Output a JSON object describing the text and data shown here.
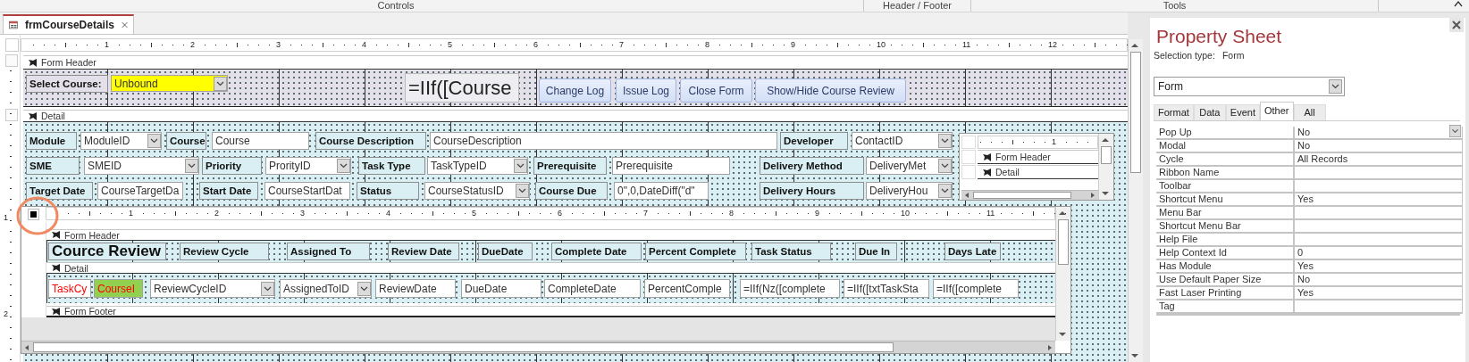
{
  "ribbon": {
    "groups": [
      "Controls",
      "Header / Footer",
      "Tools"
    ]
  },
  "document_tab": {
    "label": "frmCourseDetails",
    "selected": true
  },
  "design": {
    "ruler_numbers": [
      "1",
      "2",
      "3",
      "4",
      "5",
      "6",
      "7",
      "8",
      "9",
      "10",
      "11",
      "12"
    ],
    "vertical_ruler_numbers": [
      "1",
      "2"
    ],
    "form_header": {
      "title": "Form Header",
      "controls": [
        {
          "kind": "label",
          "text": "Select Course:"
        },
        {
          "kind": "combo",
          "text": "Unbound",
          "color": "#ffff00"
        },
        {
          "kind": "large-textbox",
          "text": "=IIf([Course"
        },
        {
          "kind": "button",
          "text": "Change Log"
        },
        {
          "kind": "button",
          "text": "Issue Log"
        },
        {
          "kind": "button",
          "text": "Close Form"
        },
        {
          "kind": "button",
          "text": "Show/Hide Course Review"
        }
      ]
    },
    "detail": {
      "title": "Detail",
      "controls": [
        {
          "kind": "label",
          "text": "Module"
        },
        {
          "kind": "combo",
          "text": "ModuleID"
        },
        {
          "kind": "label",
          "text": "Course"
        },
        {
          "kind": "textbox",
          "text": "Course"
        },
        {
          "kind": "label",
          "text": "Course Description"
        },
        {
          "kind": "textbox",
          "text": "CourseDescription"
        },
        {
          "kind": "label",
          "text": "Developer"
        },
        {
          "kind": "combo",
          "text": "ContactID"
        },
        {
          "kind": "label",
          "text": "SME"
        },
        {
          "kind": "combo",
          "text": "SMEID"
        },
        {
          "kind": "label",
          "text": "Priority"
        },
        {
          "kind": "combo",
          "text": "ProrityID"
        },
        {
          "kind": "label",
          "text": "Task Type"
        },
        {
          "kind": "combo",
          "text": "TaskTypeID"
        },
        {
          "kind": "label",
          "text": "Prerequisite"
        },
        {
          "kind": "textbox",
          "text": "Prerequisite"
        },
        {
          "kind": "label",
          "text": "Delivery Method"
        },
        {
          "kind": "combo",
          "text": "DeliveryMet"
        },
        {
          "kind": "label",
          "text": "Target Date"
        },
        {
          "kind": "textbox",
          "text": "CourseTargetDa"
        },
        {
          "kind": "label",
          "text": "Start Date"
        },
        {
          "kind": "textbox",
          "text": "CourseStartDat"
        },
        {
          "kind": "label",
          "text": "Status"
        },
        {
          "kind": "combo",
          "text": "CourseStatusID"
        },
        {
          "kind": "label",
          "text": "Course Due"
        },
        {
          "kind": "textbox",
          "text": "0\",0,DateDiff(\"d\""
        },
        {
          "kind": "label",
          "text": "Delivery Hours"
        },
        {
          "kind": "combo",
          "text": "DeliveryHou"
        }
      ],
      "mini_subform": {
        "ruler_numbers": [
          "1"
        ],
        "sections": [
          {
            "title": "Form Header"
          },
          {
            "title": "Detail"
          }
        ]
      },
      "subform": {
        "ruler_numbers": [
          "1",
          "2",
          "3",
          "4",
          "5",
          "6",
          "7",
          "8",
          "9",
          "10",
          "11"
        ],
        "header": {
          "title": "Form Header",
          "controls": [
            {
              "kind": "title-label",
              "text": "Cource Review"
            },
            {
              "kind": "label",
              "text": "Review Cycle"
            },
            {
              "kind": "label",
              "text": "Assigned To"
            },
            {
              "kind": "label",
              "text": "Review Date"
            },
            {
              "kind": "label",
              "text": "DueDate"
            },
            {
              "kind": "label",
              "text": "Complete Date"
            },
            {
              "kind": "label",
              "text": "Percent Complete"
            },
            {
              "kind": "label",
              "text": "Task Status"
            },
            {
              "kind": "label",
              "text": "Due In"
            },
            {
              "kind": "label",
              "text": "Days Late"
            }
          ]
        },
        "detail": {
          "title": "Detail",
          "controls": [
            {
              "kind": "textbox",
              "text": "TaskCy",
              "emphasis": true
            },
            {
              "kind": "textbox",
              "text": "CourseI",
              "emphasis": true,
              "color": "#92d050"
            },
            {
              "kind": "combo",
              "text": "ReviewCycleID"
            },
            {
              "kind": "combo",
              "text": "AssignedToID"
            },
            {
              "kind": "textbox",
              "text": "ReviewDate"
            },
            {
              "kind": "textbox",
              "text": "DueDate"
            },
            {
              "kind": "textbox",
              "text": "CompleteDate"
            },
            {
              "kind": "textbox",
              "text": "PercentComple"
            },
            {
              "kind": "textbox",
              "text": "=IIf(Nz([complete"
            },
            {
              "kind": "textbox",
              "text": "=IIf([txtTaskSta"
            },
            {
              "kind": "textbox",
              "text": "=IIf([complete"
            }
          ]
        },
        "footer": {
          "title": "Form Footer"
        }
      }
    }
  },
  "annotations": [
    {
      "kind": "circle"
    }
  ],
  "property_sheet": {
    "title": "Property Sheet",
    "selection_label": "Selection type:",
    "selection_value": "Form",
    "object": "Form",
    "tabs": [
      {
        "label": "Format",
        "selected": false
      },
      {
        "label": "Data",
        "selected": false
      },
      {
        "label": "Event",
        "selected": false
      },
      {
        "label": "Other",
        "selected": true
      },
      {
        "label": "All",
        "selected": false
      }
    ],
    "properties": [
      {
        "name": "Pop Up",
        "value": "No",
        "kind": "dropdown"
      },
      {
        "name": "Modal",
        "value": "No",
        "kind": "text"
      },
      {
        "name": "Cycle",
        "value": "All Records",
        "kind": "text"
      },
      {
        "name": "Ribbon Name",
        "kind": "text"
      },
      {
        "name": "Toolbar",
        "kind": "text"
      },
      {
        "name": "Shortcut Menu",
        "value": "Yes",
        "kind": "text"
      },
      {
        "name": "Menu Bar",
        "kind": "text"
      },
      {
        "name": "Shortcut Menu Bar",
        "kind": "text"
      },
      {
        "name": "Help File",
        "kind": "text"
      },
      {
        "name": "Help Context Id",
        "value": "0",
        "kind": "text"
      },
      {
        "name": "Has Module",
        "value": "Yes",
        "kind": "text"
      },
      {
        "name": "Use Default Paper Size",
        "value": "No",
        "kind": "text"
      },
      {
        "name": "Fast Laser Printing",
        "value": "Yes",
        "kind": "text"
      },
      {
        "name": "Tag",
        "kind": "text"
      }
    ]
  }
}
